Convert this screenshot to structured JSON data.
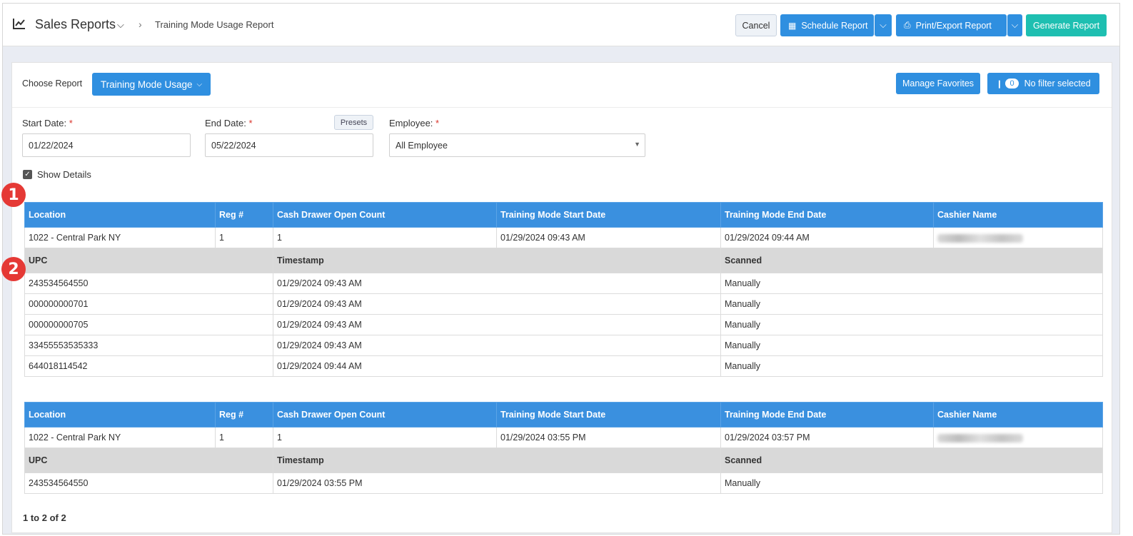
{
  "header": {
    "title": "Sales Reports",
    "breadcrumb": "Training Mode Usage Report",
    "buttons": {
      "cancel": "Cancel",
      "schedule": "Schedule Report",
      "print_export": "Print/Export Report",
      "generate": "Generate Report"
    }
  },
  "controls": {
    "choose_report_label": "Choose Report",
    "choose_report_value": "Training Mode Usage",
    "manage_favorites": "Manage Favorites",
    "filter_count": "0",
    "filter_label": "No filter selected"
  },
  "filters": {
    "start_label": "Start Date:",
    "start_value": "01/22/2024",
    "end_label": "End Date:",
    "end_value": "05/22/2024",
    "presets": "Presets",
    "employee_label": "Employee:",
    "employee_value": "All Employee",
    "required_mark": "*",
    "show_details": "Show Details"
  },
  "table_headers": {
    "location": "Location",
    "reg": "Reg #",
    "cash_drawer": "Cash Drawer Open Count",
    "start": "Training Mode Start Date",
    "end": "Training Mode End Date",
    "cashier": "Cashier Name",
    "upc": "UPC",
    "timestamp": "Timestamp",
    "scanned": "Scanned"
  },
  "reports": [
    {
      "location": "1022 - Central Park NY",
      "reg": "1",
      "cash_drawer": "1",
      "start": "01/29/2024 09:43 AM",
      "end": "01/29/2024 09:44 AM",
      "items": [
        {
          "upc": "243534564550",
          "timestamp": "01/29/2024 09:43 AM",
          "scanned": "Manually"
        },
        {
          "upc": "000000000701",
          "timestamp": "01/29/2024 09:43 AM",
          "scanned": "Manually"
        },
        {
          "upc": "000000000705",
          "timestamp": "01/29/2024 09:43 AM",
          "scanned": "Manually"
        },
        {
          "upc": "33455553535333",
          "timestamp": "01/29/2024 09:43 AM",
          "scanned": "Manually"
        },
        {
          "upc": "644018114542",
          "timestamp": "01/29/2024 09:44 AM",
          "scanned": "Manually"
        }
      ]
    },
    {
      "location": "1022 - Central Park NY",
      "reg": "1",
      "cash_drawer": "1",
      "start": "01/29/2024 03:55 PM",
      "end": "01/29/2024 03:57 PM",
      "items": [
        {
          "upc": "243534564550",
          "timestamp": "01/29/2024 03:55 PM",
          "scanned": "Manually"
        }
      ]
    }
  ],
  "pager": "1 to 2 of 2",
  "markers": [
    "1",
    "2"
  ],
  "colors": {
    "primary": "#2f8fe0",
    "header_row": "#3a90df",
    "generate": "#1ebfb1",
    "marker": "#e53935"
  }
}
